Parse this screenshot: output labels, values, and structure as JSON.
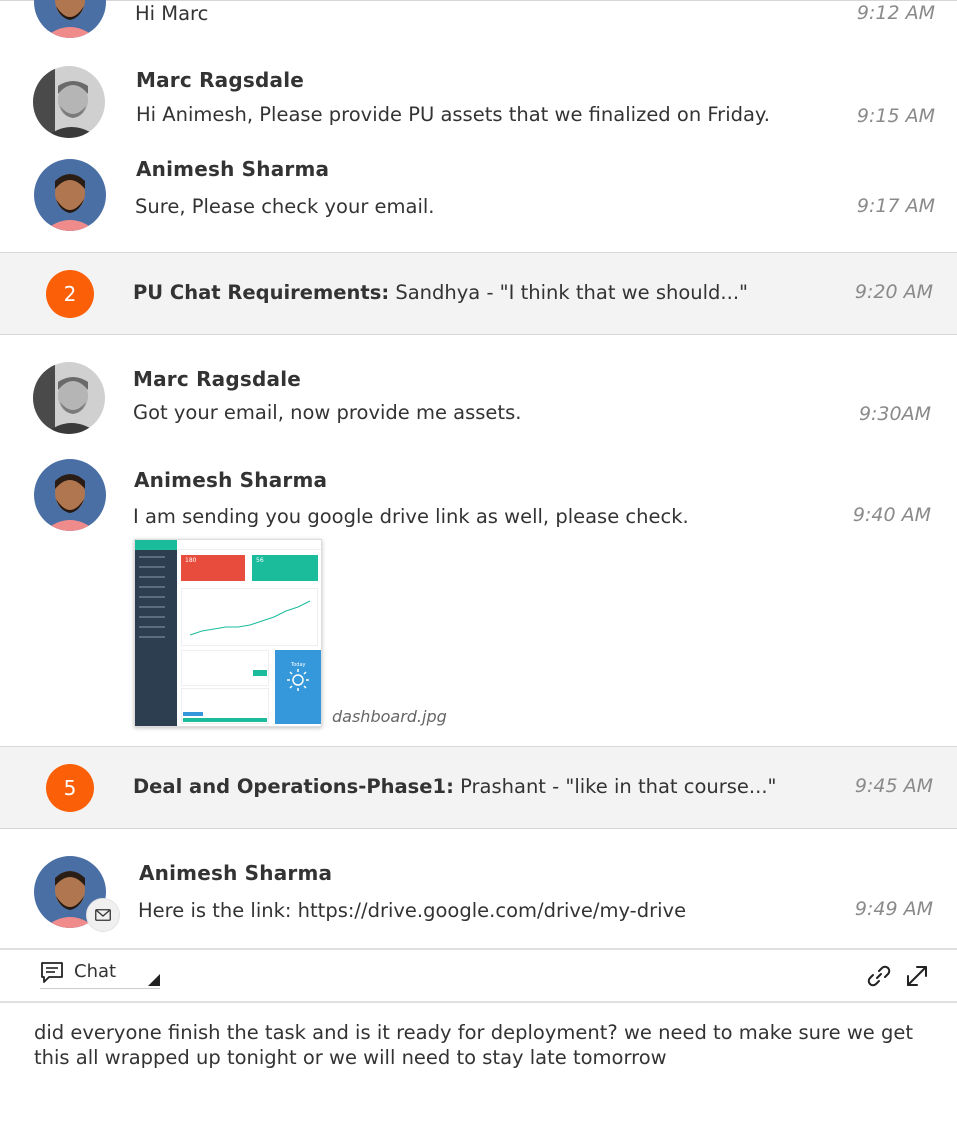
{
  "messages": [
    {
      "name": "",
      "text": "Hi Marc",
      "time": "9:12 AM",
      "avatar": "animesh"
    },
    {
      "name": "Marc Ragsdale",
      "text": "Hi Animesh, Please provide PU assets that we finalized on Friday.",
      "time": "9:15 AM",
      "avatar": "marc"
    },
    {
      "name": "Animesh Sharma",
      "text": "Sure, Please check your email.",
      "time": "9:17 AM",
      "avatar": "animesh"
    }
  ],
  "groups": [
    {
      "count": "2",
      "title": "PU Chat Requirements:",
      "preview": " Sandhya - \"I think that we should...\"",
      "time": "9:20 AM"
    },
    {
      "count": "5",
      "title": "Deal and Operations-Phase1:",
      "preview": " Prashant - \"like in that course...\"",
      "time": "9:45 AM"
    }
  ],
  "messages2": [
    {
      "name": "Marc Ragsdale",
      "text": "Got your email, now provide me assets.",
      "time": "9:30AM",
      "avatar": "marc"
    },
    {
      "name": "Animesh Sharma",
      "text": "I am sending you google drive link as well, please check.",
      "time": "9:40 AM",
      "avatar": "animesh"
    }
  ],
  "attachment": {
    "filename": "dashboard.jpg",
    "thumb_values": [
      "180",
      "56"
    ],
    "thumb_weather": "Today"
  },
  "messages3": [
    {
      "name": "Animesh Sharma",
      "text": "Here is the link: https://drive.google.com/drive/my-drive",
      "time": "9:49 AM",
      "avatar": "animesh",
      "status_icon": "mail-icon"
    }
  ],
  "toolbar": {
    "channel_label": "Chat",
    "channel_icon": "chat-bubble-icon",
    "link_icon": "link-icon",
    "expand_icon": "expand-icon"
  },
  "composer": {
    "text": "did everyone finish the task and is it ready for deployment? we need to make sure we get this all wrapped up tonight or we will need to stay late tomorrow"
  },
  "colors": {
    "badge": "#fb5f07",
    "group_bg": "#f3f3f3",
    "time": "#8a8a8a"
  }
}
